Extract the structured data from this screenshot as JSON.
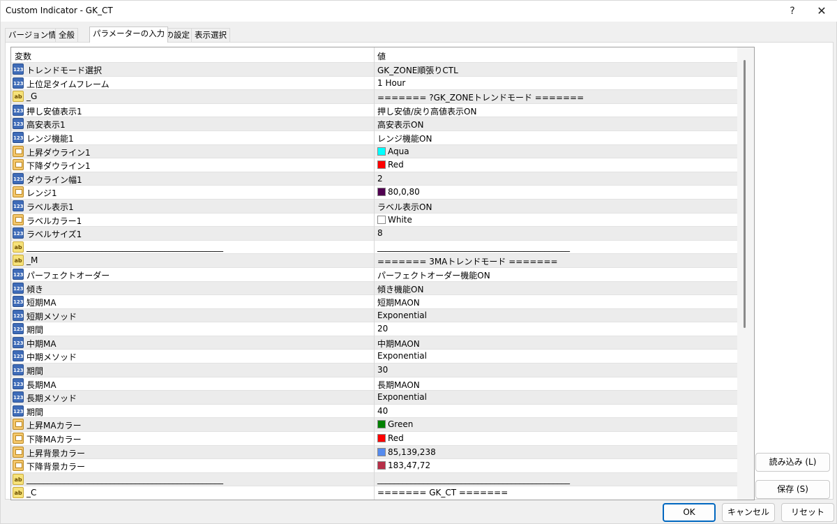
{
  "window": {
    "title": "Custom Indicator - GK_CT",
    "help": "?",
    "close": "✕"
  },
  "tabs": [
    {
      "label": "バージョン情報"
    },
    {
      "label": "全般"
    },
    {
      "label": "パラメーターの入力",
      "active": true
    },
    {
      "label": "色の設定"
    },
    {
      "label": "表示選択"
    }
  ],
  "grid": {
    "header": {
      "variable": "変数",
      "value": "値"
    },
    "rows": [
      {
        "type": "num",
        "icon": "123",
        "name": "トレンドモード選択",
        "value": "GK_ZONE順張りCTL"
      },
      {
        "type": "num",
        "icon": "123",
        "name": "上位足タイムフレーム",
        "value": "1 Hour"
      },
      {
        "type": "str",
        "icon": "ab",
        "name": "_G",
        "value": "======= ?GK_ZONEトレンドモード ======="
      },
      {
        "type": "num",
        "icon": "123",
        "name": "押し安値表示1",
        "value": "押し安値/戻り高値表示ON"
      },
      {
        "type": "num",
        "icon": "123",
        "name": "高安表示1",
        "value": "高安表示ON"
      },
      {
        "type": "num",
        "icon": "123",
        "name": "レンジ機能1",
        "value": "レンジ機能ON"
      },
      {
        "type": "clr",
        "icon": "",
        "name": "上昇ダウライン1",
        "value": "Aqua",
        "color": "#00ffff"
      },
      {
        "type": "clr",
        "icon": "",
        "name": "下降ダウライン1",
        "value": "Red",
        "color": "#ff0000"
      },
      {
        "type": "num",
        "icon": "123",
        "name": "ダウライン幅1",
        "value": "2"
      },
      {
        "type": "clr",
        "icon": "",
        "name": "レンジ1",
        "value": "80,0,80",
        "color": "#500050"
      },
      {
        "type": "num",
        "icon": "123",
        "name": "ラベル表示1",
        "value": "ラベル表示ON"
      },
      {
        "type": "clr",
        "icon": "",
        "name": "ラベルカラー1",
        "value": "White",
        "color": "#ffffff"
      },
      {
        "type": "num",
        "icon": "123",
        "name": "ラベルサイズ1",
        "value": "8"
      },
      {
        "type": "str",
        "icon": "ab",
        "name": "_______________________________________________",
        "value": "______________________________________________"
      },
      {
        "type": "str",
        "icon": "ab",
        "name": "_M",
        "value": "======= 3MAトレンドモード ======="
      },
      {
        "type": "num",
        "icon": "123",
        "name": "パーフェクトオーダー",
        "value": "パーフェクトオーダー機能ON"
      },
      {
        "type": "num",
        "icon": "123",
        "name": "傾き",
        "value": "傾き機能ON"
      },
      {
        "type": "num",
        "icon": "123",
        "name": "短期MA",
        "value": "短期MAON"
      },
      {
        "type": "num",
        "icon": "123",
        "name": "短期メソッド",
        "value": "Exponential"
      },
      {
        "type": "num",
        "icon": "123",
        "name": "期間",
        "value": "20"
      },
      {
        "type": "num",
        "icon": "123",
        "name": "中期MA",
        "value": "中期MAON"
      },
      {
        "type": "num",
        "icon": "123",
        "name": "中期メソッド",
        "value": "Exponential"
      },
      {
        "type": "num",
        "icon": "123",
        "name": "期間",
        "value": "30"
      },
      {
        "type": "num",
        "icon": "123",
        "name": "長期MA",
        "value": "長期MAON"
      },
      {
        "type": "num",
        "icon": "123",
        "name": "長期メソッド",
        "value": "Exponential"
      },
      {
        "type": "num",
        "icon": "123",
        "name": "期間",
        "value": "40"
      },
      {
        "type": "clr",
        "icon": "",
        "name": "上昇MAカラー",
        "value": "Green",
        "color": "#008000"
      },
      {
        "type": "clr",
        "icon": "",
        "name": "下降MAカラー",
        "value": "Red",
        "color": "#ff0000"
      },
      {
        "type": "clr",
        "icon": "",
        "name": "上昇背景カラー",
        "value": "85,139,238",
        "color": "#558bee"
      },
      {
        "type": "clr",
        "icon": "",
        "name": "下降背景カラー",
        "value": "183,47,72",
        "color": "#b72f48"
      },
      {
        "type": "str",
        "icon": "ab",
        "name": "_______________________________________________",
        "value": "______________________________________________"
      },
      {
        "type": "str",
        "icon": "ab",
        "name": "_C",
        "value": "======= GK_CT ======="
      }
    ]
  },
  "side_buttons": {
    "load": "読み込み (L)",
    "save": "保存 (S)"
  },
  "buttons": {
    "ok": "OK",
    "cancel": "キャンセル",
    "reset": "リセット"
  }
}
